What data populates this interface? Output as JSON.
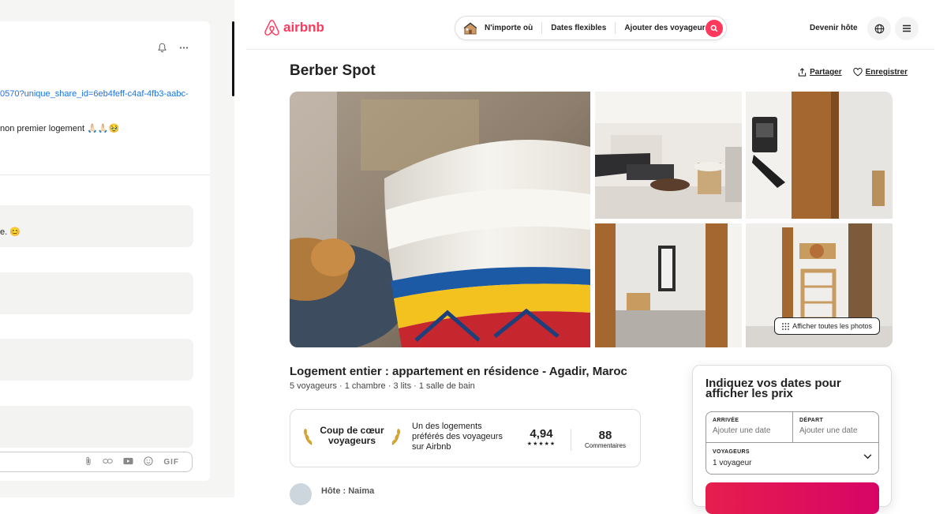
{
  "chat": {
    "link_text": "0570?unique_share_id=6eb4feff-c4af-4fb3-aabc-",
    "message_text": "non premier logement 🙏🏻🙏🏻🥹",
    "bubble1_text": "e. 😊",
    "composer_tools": [
      "paperclip-icon",
      "link-icon",
      "video-icon",
      "emoji-icon"
    ],
    "gif_label": "GIF"
  },
  "airbnb": {
    "logo_text": "airbnb",
    "brand_color": "#ff385c",
    "search": {
      "where": "N'importe où",
      "dates": "Dates flexibles",
      "guests": "Ajouter des voyageurs"
    },
    "host_label": "Devenir hôte",
    "listing_title": "Berber Spot",
    "share_label": "Partager",
    "save_label": "Enregistrer",
    "show_all_photos": "Afficher toutes les photos",
    "subtitle": "Logement entier : appartement en résidence - Agadir, Maroc",
    "details": "5 voyageurs · 1 chambre · 3 lits · 1 salle de bain",
    "favorite": {
      "badge": "Coup de cœur voyageurs",
      "description": "Un des logements préférés des voyageurs sur Airbnb",
      "rating": "4,94",
      "stars": "★★★★★",
      "reviews_count": "88",
      "reviews_label": "Commentaires"
    },
    "host_name": "Hôte : Naima",
    "booking": {
      "heading": "Indiquez vos dates pour afficher les prix",
      "checkin_label": "ARRIVÉE",
      "checkin_placeholder": "Ajouter une date",
      "checkout_label": "DÉPART",
      "checkout_placeholder": "Ajouter une date",
      "guests_label": "VOYAGEURS",
      "guests_value": "1 voyageur"
    }
  }
}
